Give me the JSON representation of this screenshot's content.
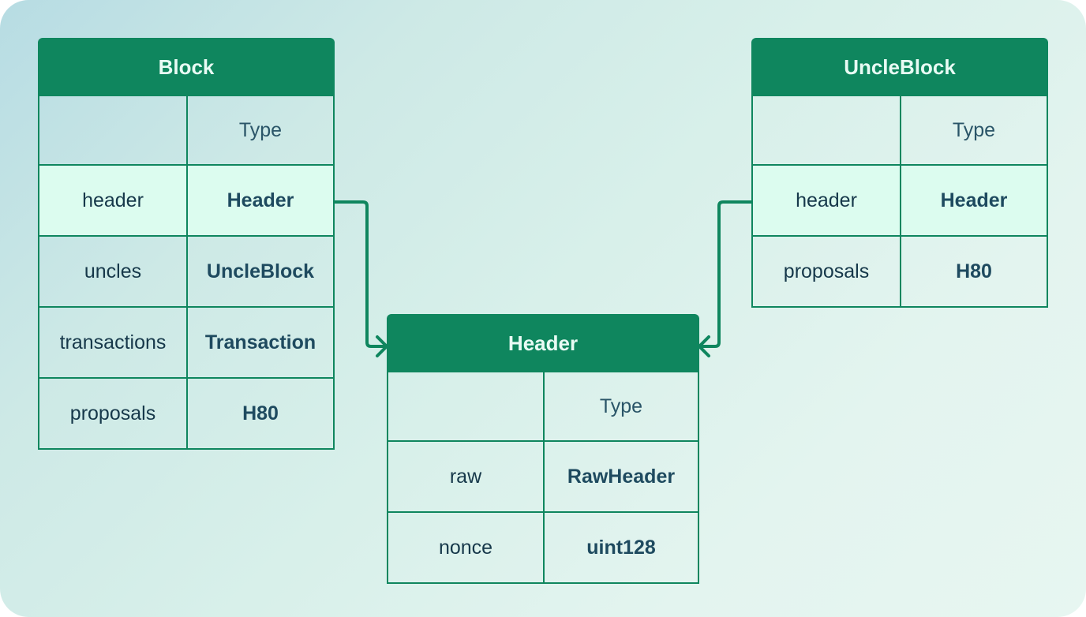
{
  "colors": {
    "accent": "#0f865e",
    "header_text": "#e8fbf4",
    "highlight_row": "#dcfcef",
    "text": "#16384a"
  },
  "tables": {
    "block": {
      "title": "Block",
      "column_header": "Type",
      "rows": [
        {
          "field": "header",
          "type": "Header",
          "highlighted": true
        },
        {
          "field": "uncles",
          "type": "UncleBlock"
        },
        {
          "field": "transactions",
          "type": "Transaction"
        },
        {
          "field": "proposals",
          "type": "H80"
        }
      ]
    },
    "uncle_block": {
      "title": "UncleBlock",
      "column_header": "Type",
      "rows": [
        {
          "field": "header",
          "type": "Header",
          "highlighted": true
        },
        {
          "field": "proposals",
          "type": "H80"
        }
      ]
    },
    "header": {
      "title": "Header",
      "column_header": "Type",
      "rows": [
        {
          "field": "raw",
          "type": "RawHeader"
        },
        {
          "field": "nonce",
          "type": "uint128"
        }
      ]
    }
  },
  "links": [
    {
      "from": "Block.header",
      "to": "Header",
      "icon": "arrow-icon"
    },
    {
      "from": "UncleBlock.header",
      "to": "Header",
      "icon": "arrow-icon"
    }
  ]
}
